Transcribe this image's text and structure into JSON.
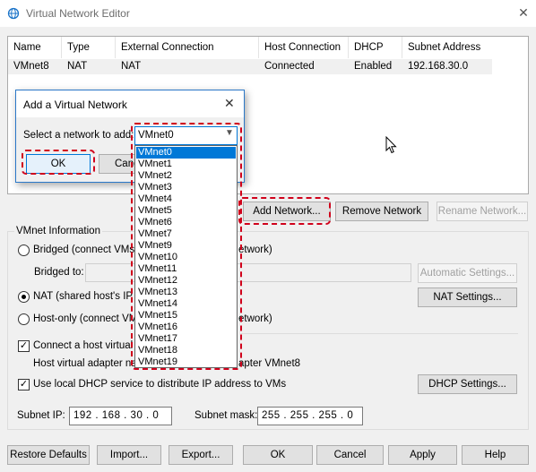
{
  "window": {
    "title": "Virtual Network Editor",
    "close_glyph": "✕"
  },
  "table": {
    "columns": [
      "Name",
      "Type",
      "External Connection",
      "Host Connection",
      "DHCP",
      "Subnet Address"
    ],
    "rows": [
      [
        "VMnet8",
        "NAT",
        "NAT",
        "Connected",
        "Enabled",
        "192.168.30.0"
      ]
    ]
  },
  "net_buttons": {
    "add": "Add Network...",
    "remove": "Remove Network",
    "rename": "Rename Network..."
  },
  "vmnet_info": {
    "group_label": "VMnet Information",
    "bridged_label": "Bridged (connect VMs di",
    "bridged_tail": "etwork)",
    "bridged_to_label": "Bridged to:",
    "auto_settings": "Automatic Settings...",
    "nat_label": "NAT (shared host's IP a",
    "nat_settings": "NAT Settings...",
    "hostonly_label": "Host-only (connect VMs",
    "hostonly_tail": "etwork)",
    "connect_adapter_label": "Connect a host virtual a",
    "adapter_name_label": "Host virtual adapter na",
    "adapter_name_tail": "apter VMnet8",
    "dhcp_label": "Use local DHCP service to distribute IP address to VMs",
    "dhcp_settings": "DHCP Settings...",
    "subnet_ip_label": "Subnet IP:",
    "subnet_ip": "192 . 168 . 30 . 0",
    "subnet_mask_label": "Subnet mask:",
    "subnet_mask": "255 . 255 . 255 . 0"
  },
  "bottom_buttons": {
    "restore": "Restore Defaults",
    "import": "Import...",
    "export": "Export...",
    "ok": "OK",
    "cancel": "Cancel",
    "apply": "Apply",
    "help": "Help"
  },
  "dialog": {
    "title": "Add a Virtual Network",
    "close_glyph": "✕",
    "select_label": "Select a network to add:",
    "selected": "VMnet0",
    "ok": "OK",
    "cancel_partial": "Canc",
    "options": [
      "VMnet0",
      "VMnet1",
      "VMnet2",
      "VMnet3",
      "VMnet4",
      "VMnet5",
      "VMnet6",
      "VMnet7",
      "VMnet9",
      "VMnet10",
      "VMnet11",
      "VMnet12",
      "VMnet13",
      "VMnet14",
      "VMnet15",
      "VMnet16",
      "VMnet17",
      "VMnet18",
      "VMnet19"
    ]
  },
  "colors": {
    "highlight": "#d0011b",
    "selection": "#0078d7"
  }
}
